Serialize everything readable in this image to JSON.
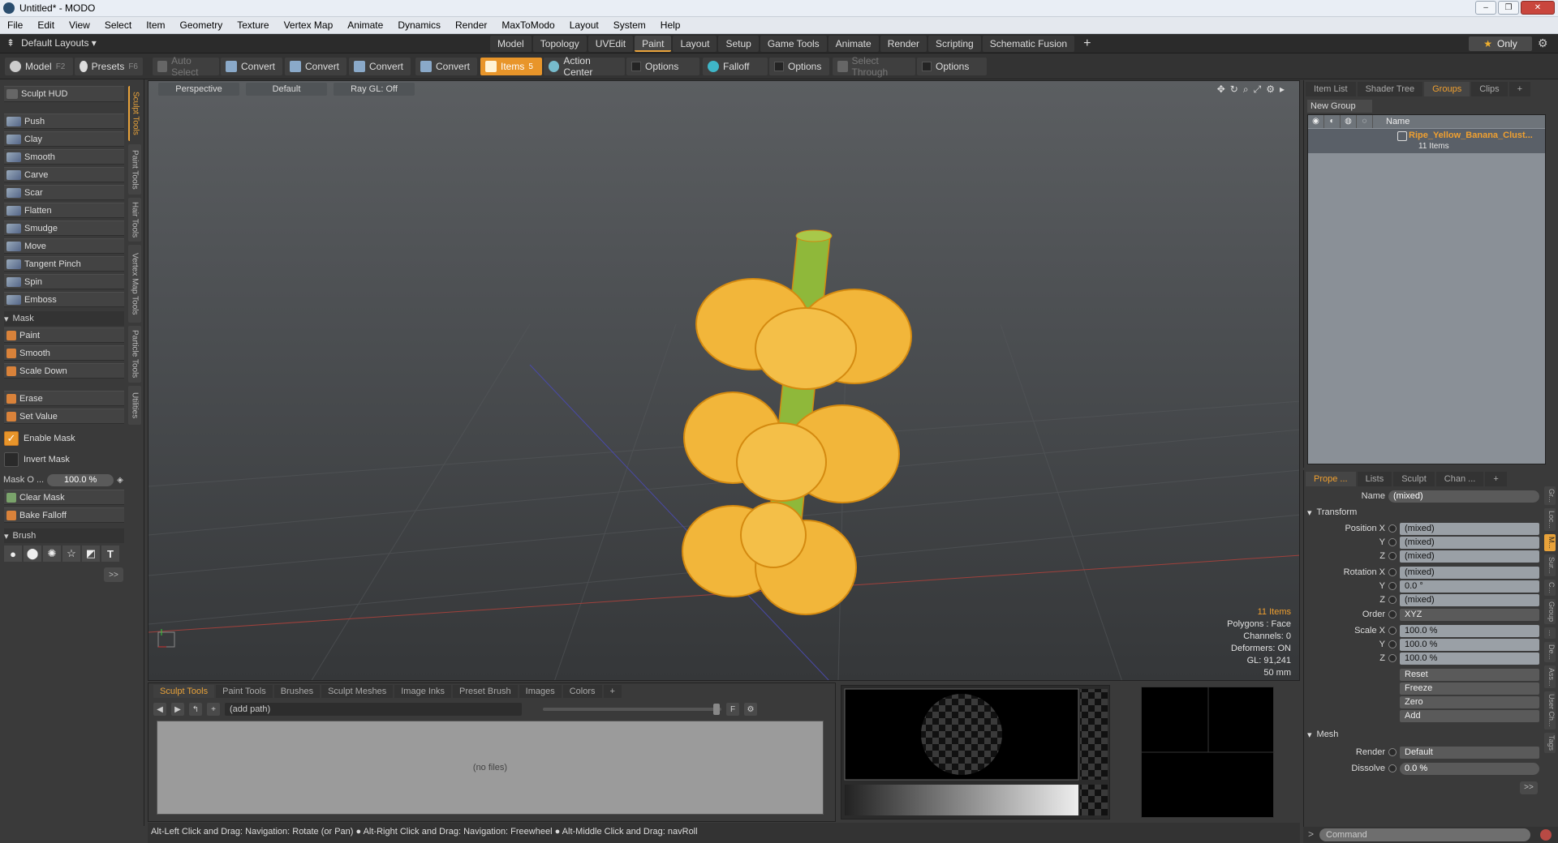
{
  "window": {
    "title": "Untitled* - MODO",
    "controls": [
      "–",
      "❐",
      "✕"
    ]
  },
  "menu": [
    "File",
    "Edit",
    "View",
    "Select",
    "Item",
    "Geometry",
    "Texture",
    "Vertex Map",
    "Animate",
    "Dynamics",
    "Render",
    "MaxToModo",
    "Layout",
    "System",
    "Help"
  ],
  "layoutbar": {
    "layouts_label": "Default Layouts ▾",
    "tabs": [
      "Model",
      "Topology",
      "UVEdit",
      "Paint",
      "Layout",
      "Setup",
      "Game Tools",
      "Animate",
      "Render",
      "Scripting",
      "Schematic Fusion"
    ],
    "active_tab": "Paint",
    "plus": "+",
    "only_label": "Only"
  },
  "toolbar": {
    "model": "Model",
    "model_key": "F2",
    "presets": "Presets",
    "presets_key": "F6",
    "auto_select": "Auto Select",
    "convert": "Convert",
    "items": "Items",
    "items_key": "5",
    "action_center": "Action Center",
    "options": "Options",
    "falloff": "Falloff",
    "select_through": "Select Through"
  },
  "left": {
    "hud": "Sculpt HUD",
    "vtabs": [
      "Sculpt Tools",
      "Paint Tools",
      "Hair Tools",
      "Vertex Map Tools",
      "Particle Tools",
      "Utilities"
    ],
    "tools": [
      "Push",
      "Clay",
      "Smooth",
      "Carve",
      "Scar",
      "Flatten",
      "Smudge",
      "Move",
      "Tangent Pinch",
      "Spin",
      "Emboss"
    ],
    "mask_header": "Mask",
    "mask_tools": [
      "Paint",
      "Smooth",
      "Scale Down"
    ],
    "erase": "Erase",
    "set_value": "Set Value",
    "enable_mask": "Enable Mask",
    "invert_mask": "Invert Mask",
    "mask_opacity_label": "Mask O ...",
    "mask_opacity": "100.0 %",
    "clear_mask": "Clear Mask",
    "bake_falloff": "Bake Falloff",
    "brush_header": "Brush",
    "more": ">>"
  },
  "viewport": {
    "view": "Perspective",
    "shading": "Default",
    "raygl": "Ray GL: Off",
    "info": {
      "items": "11 Items",
      "polygons": "Polygons : Face",
      "channels": "Channels: 0",
      "deformers": "Deformers: ON",
      "gl": "GL: 91,241",
      "scale": "50 mm"
    },
    "colors": {
      "banana": "#f2b63a",
      "banana_edge": "#d48a10",
      "stem": "#8fb83a"
    }
  },
  "browser": {
    "tabs": [
      "Sculpt Tools",
      "Paint Tools",
      "Brushes",
      "Sculpt Meshes",
      "Image Inks",
      "Preset Brush",
      "Images",
      "Colors",
      "+"
    ],
    "path": "(add path)",
    "empty": "(no files)"
  },
  "status": "Alt-Left Click and Drag: Navigation: Rotate (or Pan) ● Alt-Right Click and Drag: Navigation: Freewheel ● Alt-Middle Click and Drag: navRoll",
  "groups": {
    "tabs": [
      "Item List",
      "Shader Tree",
      "Groups",
      "Clips",
      "+"
    ],
    "new_group": "New Group",
    "name_col": "Name",
    "item_name": "Ripe_Yellow_Banana_Clust...",
    "item_count": "11 Items"
  },
  "properties": {
    "tabs": [
      "Prope ...",
      "Lists",
      "Sculpt",
      "Chan ...",
      "+"
    ],
    "name_label": "Name",
    "name_value": "(mixed)",
    "transform": "Transform",
    "rows": [
      {
        "label": "Position X",
        "value": "(mixed)"
      },
      {
        "label": "Y",
        "value": "(mixed)"
      },
      {
        "label": "Z",
        "value": "(mixed)"
      },
      {
        "label": "Rotation X",
        "value": "(mixed)"
      },
      {
        "label": "Y",
        "value": "0.0 °"
      },
      {
        "label": "Z",
        "value": "(mixed)"
      }
    ],
    "order_label": "Order",
    "order_value": "XYZ",
    "scale_rows": [
      {
        "label": "Scale X",
        "value": "100.0 %"
      },
      {
        "label": "Y",
        "value": "100.0 %"
      },
      {
        "label": "Z",
        "value": "100.0 %"
      }
    ],
    "actions": [
      "Reset",
      "Freeze",
      "Zero",
      "Add"
    ],
    "mesh": "Mesh",
    "render_label": "Render",
    "render_value": "Default",
    "dissolve_label": "Dissolve",
    "dissolve_value": "0.0 %",
    "side_tabs": [
      "Gr...",
      "Loc...",
      "M...",
      "Sur...",
      "C...",
      "Group",
      "...",
      "De...",
      "Ass...",
      "User Ch...",
      "Tags"
    ],
    "more": ">>"
  },
  "command": {
    "placeholder": "Command"
  }
}
